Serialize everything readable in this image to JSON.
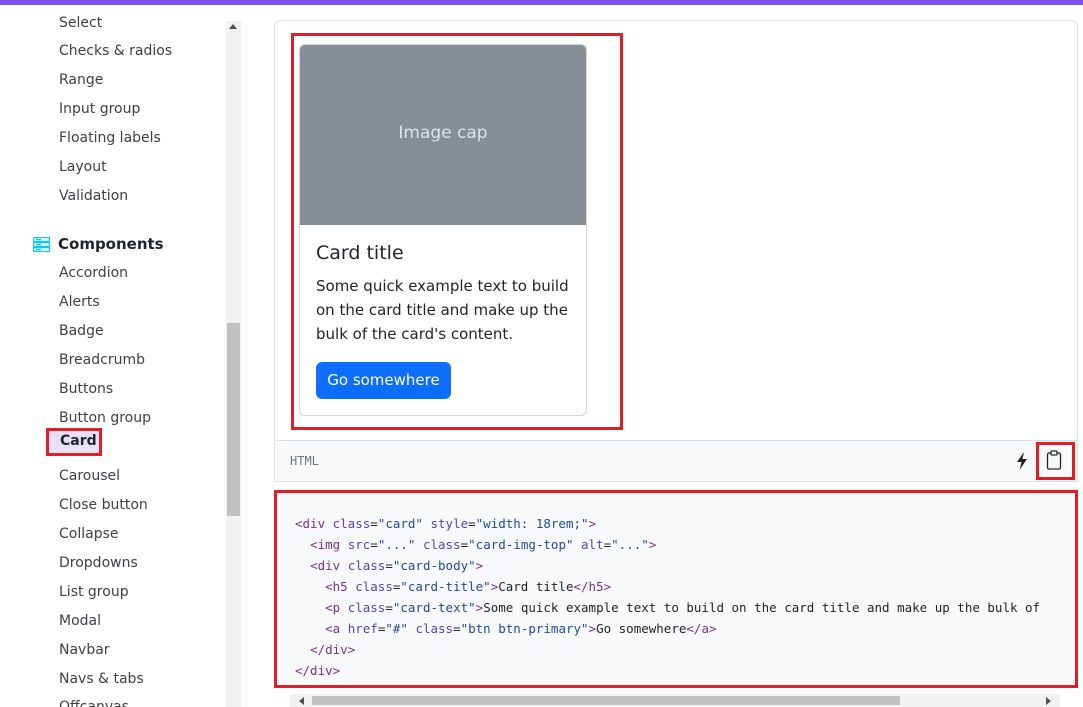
{
  "sidebar": {
    "forms_items": [
      "Select",
      "Checks & radios",
      "Range",
      "Input group",
      "Floating labels",
      "Layout",
      "Validation"
    ],
    "section_title": "Components",
    "section_icon": "components-icon",
    "component_items": [
      "Accordion",
      "Alerts",
      "Badge",
      "Breadcrumb",
      "Buttons",
      "Button group",
      "Card",
      "Carousel",
      "Close button",
      "Collapse",
      "Dropdowns",
      "List group",
      "Modal",
      "Navbar",
      "Navs & tabs",
      "Offcanvas"
    ],
    "active_item": "Card"
  },
  "card": {
    "image_cap": "Image cap",
    "title": "Card title",
    "text": "Some quick example text to build on the card title and make up the bulk of the card's content.",
    "button": "Go somewhere"
  },
  "code_header": {
    "lang": "HTML",
    "bolt_icon": "bolt-icon",
    "copy_icon": "clipboard-icon"
  },
  "code": {
    "lines": [
      "<div class=\"card\" style=\"width: 18rem;\">",
      "  <img src=\"...\" class=\"card-img-top\" alt=\"...\">",
      "  <div class=\"card-body\">",
      "    <h5 class=\"card-title\">Card title</h5>",
      "    <p class=\"card-text\">Some quick example text to build on the card title and make up the bulk of",
      "    <a href=\"#\" class=\"btn btn-primary\">Go somewhere</a>",
      "  </div>",
      "</div>"
    ]
  },
  "colors": {
    "accent": "#7952e8",
    "primary": "#0d6efd",
    "highlight": "#e01e25",
    "image_cap_bg": "#868e96"
  }
}
